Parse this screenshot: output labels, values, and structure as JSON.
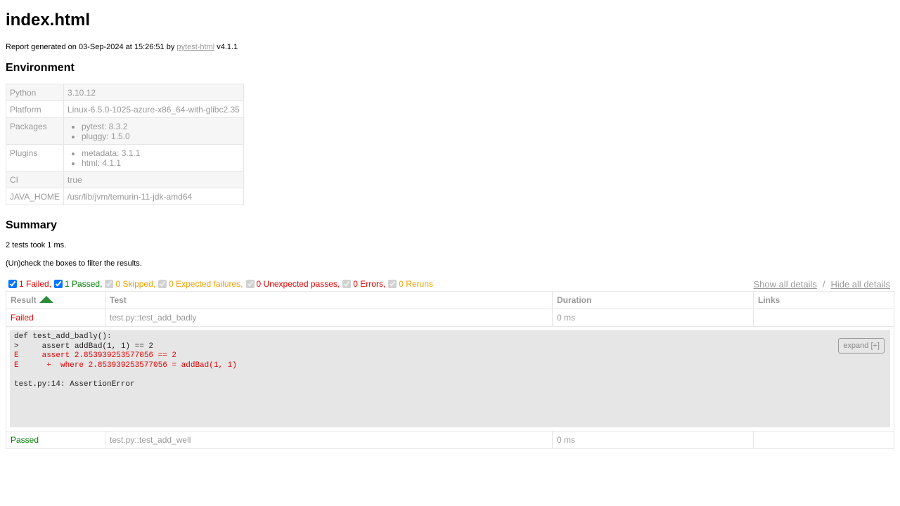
{
  "title": "index.html",
  "generated": {
    "prefix": "Report generated on 03-Sep-2024 at 15:26:51 by ",
    "link": "pytest-html",
    "suffix": " v4.1.1"
  },
  "environment": {
    "title": "Environment",
    "rows": [
      {
        "key": "Python",
        "value": "3.10.12"
      },
      {
        "key": "Platform",
        "value": "Linux-6.5.0-1025-azure-x86_64-with-glibc2.35"
      },
      {
        "key": "Packages",
        "items": [
          "pytest: 8.3.2",
          "pluggy: 1.5.0"
        ]
      },
      {
        "key": "Plugins",
        "items": [
          "metadata: 3.1.1",
          "html: 4.1.1"
        ]
      },
      {
        "key": "CI",
        "value": "true"
      },
      {
        "key": "JAVA_HOME",
        "value": "/usr/lib/jvm/temurin-11-jdk-amd64"
      }
    ]
  },
  "summary": {
    "title": "Summary",
    "duration_text": "2 tests took 1 ms.",
    "filter_hint": "(Un)check the boxes to filter the results.",
    "filters": [
      {
        "label": "1 Failed,",
        "checked": true,
        "enabled": true,
        "color": "#e60000"
      },
      {
        "label": "1 Passed,",
        "checked": true,
        "enabled": true,
        "color": "#008000"
      },
      {
        "label": "0 Skipped,",
        "checked": true,
        "enabled": false,
        "color": "#f0a000"
      },
      {
        "label": "0 Expected failures,",
        "checked": true,
        "enabled": false,
        "color": "#f0a000"
      },
      {
        "label": "0 Unexpected passes,",
        "checked": true,
        "enabled": false,
        "color": "#e60000"
      },
      {
        "label": "0 Errors,",
        "checked": true,
        "enabled": false,
        "color": "#e60000"
      },
      {
        "label": "0 Reruns",
        "checked": true,
        "enabled": false,
        "color": "#f0a000"
      }
    ],
    "show_all": "Show all details",
    "separator": "/",
    "hide_all": "Hide all details"
  },
  "results": {
    "headers": [
      "Result",
      "Test",
      "Duration",
      "Links"
    ],
    "rows": [
      {
        "result": "Failed",
        "test": "test.py::test_add_badly",
        "duration": "0 ms",
        "links": "",
        "log": [
          {
            "text": "def test_add_badly():",
            "error": false
          },
          {
            "text": ">     assert addBad(1, 1) == 2",
            "error": false
          },
          {
            "text": "E     assert 2.853939253577056 == 2",
            "error": true
          },
          {
            "text": "E      +  where 2.853939253577056 = addBad(1, 1)",
            "error": true
          },
          {
            "text": "",
            "error": false
          },
          {
            "text": "test.py:14: AssertionError",
            "error": false
          }
        ],
        "expand_label": "expand [+]"
      },
      {
        "result": "Passed",
        "test": "test.py::test_add_well",
        "duration": "0 ms",
        "links": ""
      }
    ]
  }
}
